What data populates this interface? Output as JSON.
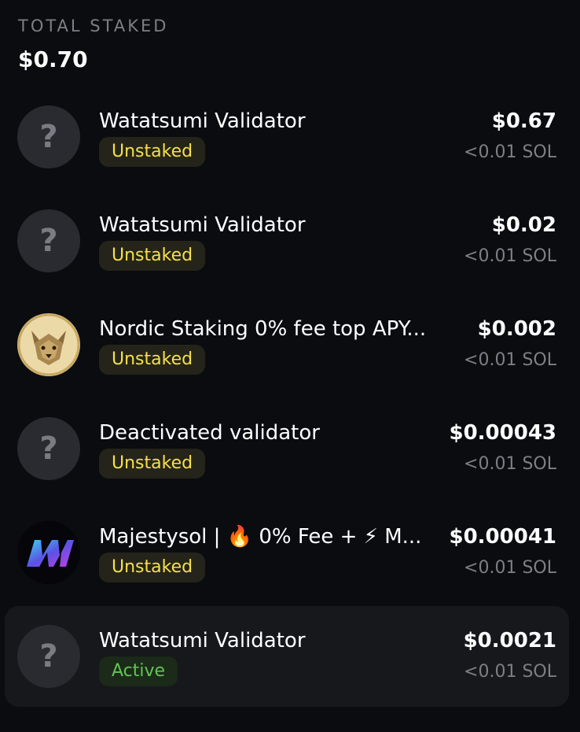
{
  "header": {
    "label": "TOTAL STAKED",
    "total": "$0.70"
  },
  "validators": [
    {
      "name": "Watatsumi Validator",
      "status": "Unstaked",
      "usd": "$0.67",
      "sol": "<0.01 SOL",
      "avatar": "question-mark-icon"
    },
    {
      "name": "Watatsumi Validator",
      "status": "Unstaked",
      "usd": "$0.02",
      "sol": "<0.01 SOL",
      "avatar": "question-mark-icon"
    },
    {
      "name": "Nordic Staking 0% fee top APY...",
      "status": "Unstaked",
      "usd": "$0.002",
      "sol": "<0.01 SOL",
      "avatar": "wolf-logo"
    },
    {
      "name": "Deactivated validator",
      "status": "Unstaked",
      "usd": "$0.00043",
      "sol": "<0.01 SOL",
      "avatar": "question-mark-icon"
    },
    {
      "name": "Majestysol | 🔥 0% Fee + ⚡ M...",
      "status": "Unstaked",
      "usd": "$0.00041",
      "sol": "<0.01 SOL",
      "avatar": "majestysol-logo"
    },
    {
      "name": "Watatsumi Validator",
      "status": "Active",
      "usd": "$0.0021",
      "sol": "<0.01 SOL",
      "avatar": "question-mark-icon"
    }
  ],
  "colors": {
    "background": "#0b0c10",
    "unstaked_text": "#f5e04a",
    "active_text": "#63c455",
    "muted_text": "#7d7f86"
  }
}
